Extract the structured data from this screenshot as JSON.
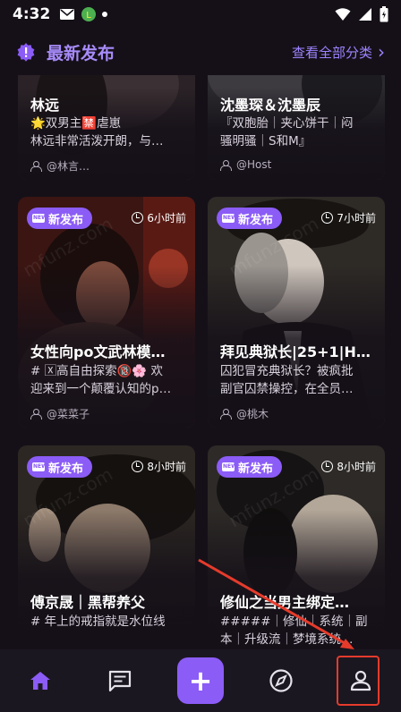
{
  "status_bar": {
    "time": "4:32"
  },
  "header": {
    "title": "最新发布",
    "view_all": "查看全部分类",
    "chevron": "›"
  },
  "cards": [
    {
      "title": "林远",
      "desc": "🌟双男主🈲虐崽\n林远非常活泼开朗，与…",
      "author": "@林言…"
    },
    {
      "title": "沈墨琛＆沈墨辰",
      "desc": "『双胞胎｜夹心饼干｜闷\n骚明骚｜S和M』",
      "author": "@Host"
    },
    {
      "badge": "新发布",
      "time": "6小时前",
      "title": "女性向po文武林模…",
      "desc": "# 🅇高自由探索🔞🌸 欢\n迎来到一个颠覆认知的p…",
      "author": "@菜菜子"
    },
    {
      "badge": "新发布",
      "time": "7小时前",
      "title": "拜见典狱长|25+1|HT…",
      "desc": "囚犯冒充典狱长？被疯批\n副官囚禁操控，在全员…",
      "author": "@桃木"
    },
    {
      "badge": "新发布",
      "time": "8小时前",
      "title": "傅京晟｜黑帮养父",
      "desc": "# 年上的戒指就是水位线",
      "author": ""
    },
    {
      "badge": "新发布",
      "time": "8小时前",
      "title": "修仙之当男主绑定…",
      "desc": "#####｜修仙｜系统｜副\n本｜升级流｜梦境系统…",
      "author": ""
    }
  ],
  "watermark": "mfunz.com",
  "bottom_nav": [
    {
      "icon": "home-icon"
    },
    {
      "icon": "chat-icon"
    },
    {
      "icon": "add-icon",
      "label": "+"
    },
    {
      "icon": "compass-icon"
    },
    {
      "icon": "profile-icon"
    }
  ],
  "colors": {
    "accent": "#8b5cf6",
    "background": "#151018",
    "annotation": "#e53b2c"
  }
}
